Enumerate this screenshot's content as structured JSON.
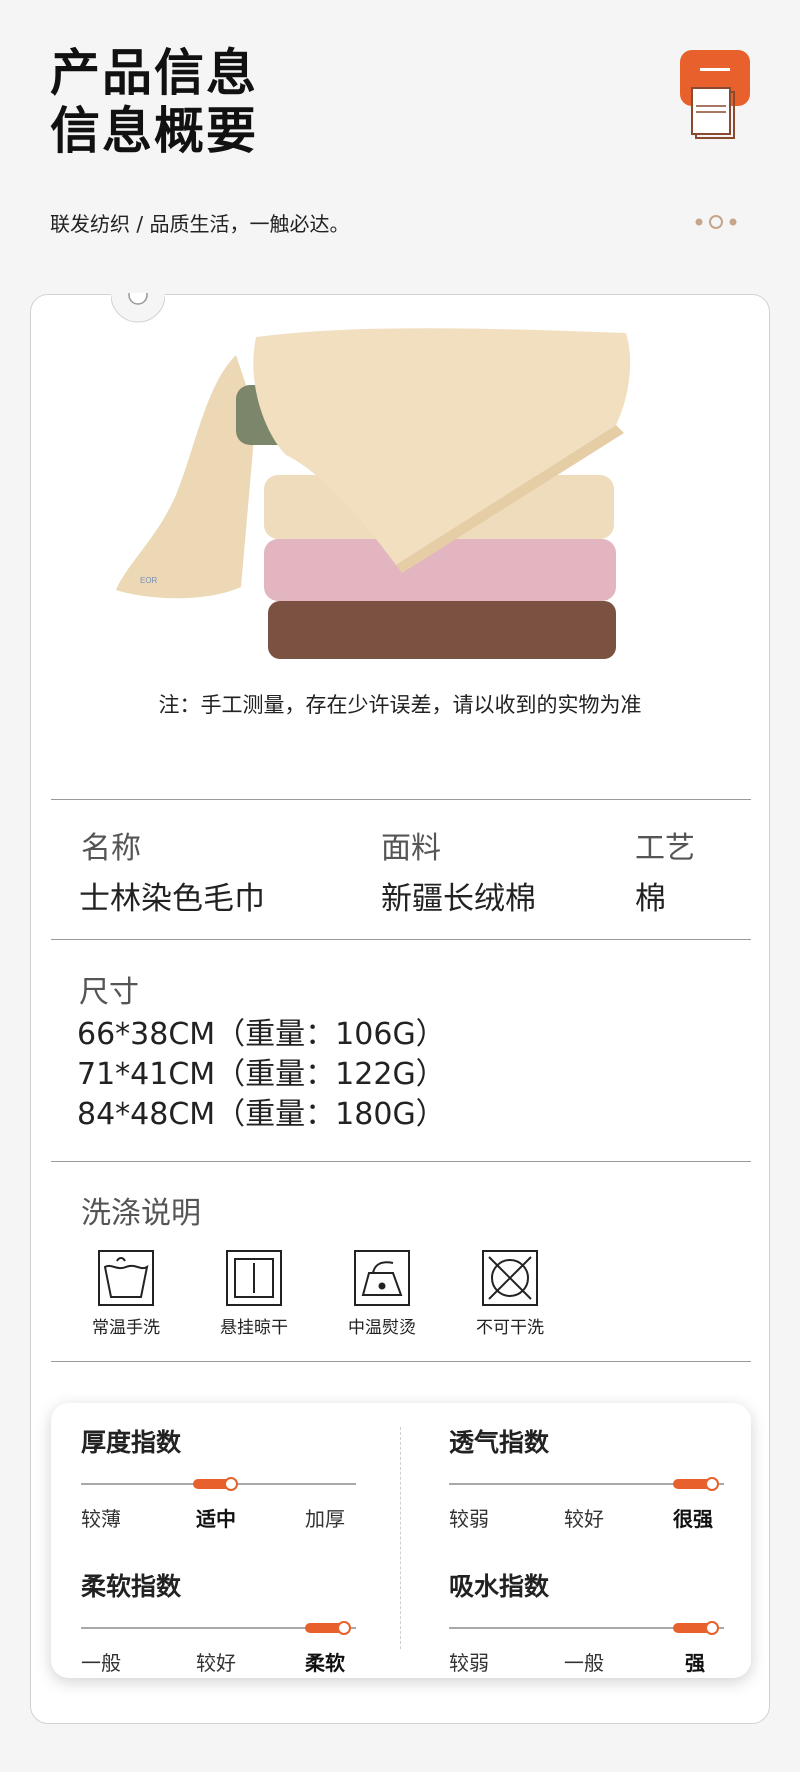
{
  "header": {
    "title_line1": "产品信息",
    "title_line2": "信息概要",
    "subtitle": "联发纺织 / 品质生活，一触必达。",
    "icon": "towel-icon",
    "accent_color": "#e8602c"
  },
  "card": {
    "image": "stacked-towels",
    "note": "注：手工测量，存在少许误差，请以收到的实物为准",
    "info": [
      {
        "label": "名称",
        "value": "士林染色毛巾"
      },
      {
        "label": "面料",
        "value": "新疆长绒棉"
      },
      {
        "label": "工艺",
        "value": "棉"
      }
    ],
    "size": {
      "label": "尺寸",
      "lines": [
        "66*38CM（重量：106G）",
        "71*41CM（重量：122G）",
        "84*48CM（重量：180G）"
      ]
    },
    "care": {
      "label": "洗涤说明",
      "items": [
        {
          "icon": "hand-wash-icon",
          "text": "常温手洗"
        },
        {
          "icon": "hang-dry-icon",
          "text": "悬挂晾干"
        },
        {
          "icon": "iron-medium-icon",
          "text": "中温熨烫"
        },
        {
          "icon": "no-dry-clean-icon",
          "text": "不可干洗"
        }
      ]
    },
    "indices": [
      {
        "title": "厚度指数",
        "levels": [
          "较薄",
          "适中",
          "加厚"
        ],
        "selected": 1
      },
      {
        "title": "透气指数",
        "levels": [
          "较弱",
          "较好",
          "很强"
        ],
        "selected": 2
      },
      {
        "title": "柔软指数",
        "levels": [
          "一般",
          "较好",
          "柔软"
        ],
        "selected": 2
      },
      {
        "title": "吸水指数",
        "levels": [
          "较弱",
          "一般",
          "强"
        ],
        "selected": 2
      }
    ]
  }
}
